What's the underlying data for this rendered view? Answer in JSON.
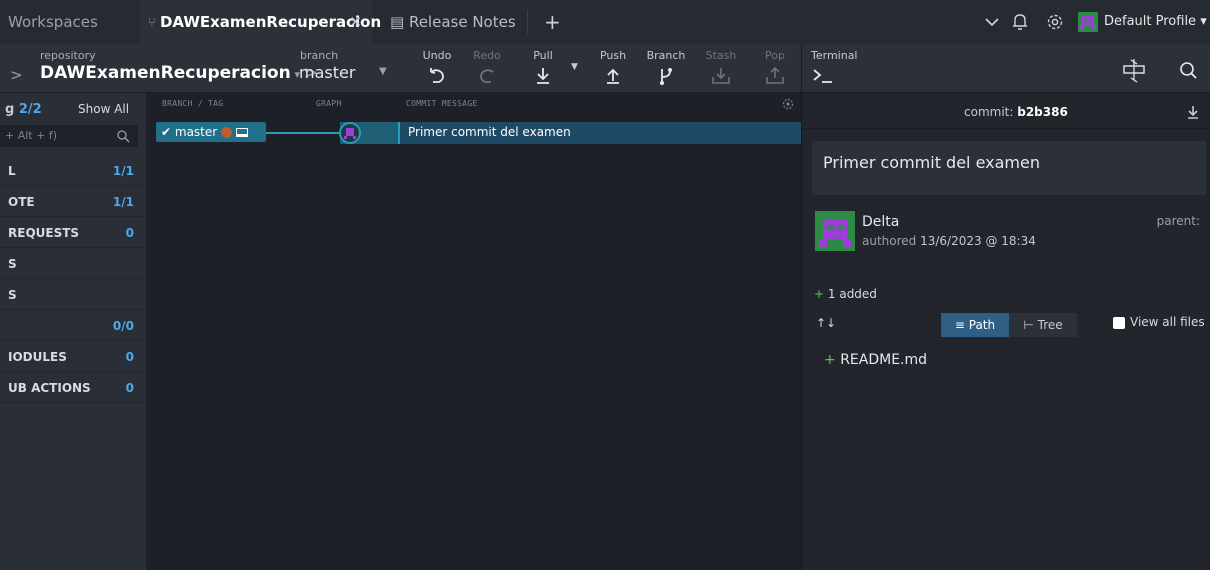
{
  "tabs": {
    "workspaces": "Workspaces",
    "repo_tab": "DAWExamenRecuperacion",
    "release_notes": "Release Notes",
    "profile": "Default Profile"
  },
  "toolbar": {
    "repo_label": "repository",
    "repo_name": "DAWExamenRecuperacion",
    "branch_label": "branch",
    "branch_name": "master",
    "undo": "Undo",
    "redo": "Redo",
    "pull": "Pull",
    "push": "Push",
    "branch": "Branch",
    "stash": "Stash",
    "pop": "Pop",
    "terminal": "Terminal"
  },
  "sidebar": {
    "viewing": "2/2",
    "viewing_prefix": "g",
    "show_all": "Show All",
    "filter_placeholder": "+ Alt + f)",
    "items": [
      {
        "label": "L",
        "count": "1/1"
      },
      {
        "label": "OTE",
        "count": "1/1"
      },
      {
        "label": "REQUESTS",
        "count": "0"
      },
      {
        "label": "S",
        "count": ""
      },
      {
        "label": "S",
        "count": ""
      },
      {
        "label": "",
        "count": "0/0"
      },
      {
        "label": "IODULES",
        "count": "0"
      },
      {
        "label": "UB ACTIONS",
        "count": "0"
      }
    ]
  },
  "graph": {
    "col_branch": "BRANCH / TAG",
    "col_graph": "GRAPH",
    "col_message": "COMMIT MESSAGE",
    "row": {
      "branch": "master",
      "message": "Primer commit del examen"
    }
  },
  "commit": {
    "label": "commit:",
    "sha": "b2b386",
    "message": "Primer commit del examen",
    "author": "Delta",
    "authored_prefix": "authored",
    "date": "13/6/2023 @ 18:34",
    "parent_label": "parent:",
    "added": "1 added",
    "path_label": "Path",
    "tree_label": "Tree",
    "view_all": "View all files",
    "files": [
      "README.md"
    ]
  },
  "colors": {
    "accent": "#4fa6e8",
    "teal": "#2a9bb8",
    "added": "#5ec25e",
    "avatar": "#9c3fd4"
  }
}
